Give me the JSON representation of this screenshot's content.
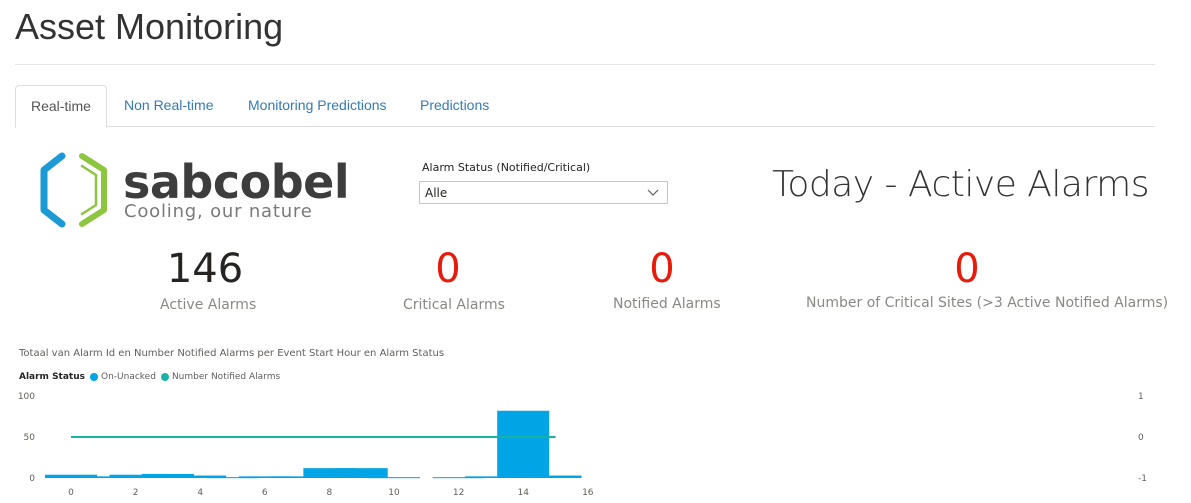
{
  "page": {
    "title": "Asset Monitoring"
  },
  "tabs": [
    {
      "label": "Real-time",
      "active": true
    },
    {
      "label": "Non Real-time",
      "active": false
    },
    {
      "label": "Monitoring Predictions",
      "active": false
    },
    {
      "label": "Predictions",
      "active": false
    }
  ],
  "logo": {
    "word": "sabcobel",
    "tagline": "Cooling, our nature",
    "colors": {
      "blue": "#1c9ad6",
      "green": "#8cc63f"
    }
  },
  "filter": {
    "label": "Alarm Status (Notified/Critical)",
    "value": "Alle"
  },
  "today_title": "Today - Active Alarms",
  "kpis": [
    {
      "value": "146",
      "label": "Active Alarms",
      "color": "#252423"
    },
    {
      "value": "0",
      "label": "Critical Alarms",
      "color": "#e81a0c"
    },
    {
      "value": "0",
      "label": "Notified Alarms",
      "color": "#e81a0c"
    },
    {
      "value": "0",
      "label": "Number of Critical Sites (>3 Active Notified Alarms)",
      "color": "#e81a0c"
    }
  ],
  "chart_data": {
    "type": "bar",
    "title": "Totaal van Alarm Id en Number Notified Alarms per Event Start Hour en Alarm Status",
    "legend_title": "Alarm Status",
    "legend_position": "top-left",
    "series": [
      {
        "name": "On-Unacked",
        "type": "bar",
        "color": "#01a4e4",
        "axis": "left",
        "x": [
          0,
          1,
          2,
          3,
          4,
          5,
          6,
          7,
          8,
          9,
          10,
          12,
          13,
          14,
          15
        ],
        "values": [
          4,
          2,
          4,
          5,
          3,
          1,
          2,
          2,
          12,
          12,
          1,
          1,
          2,
          82,
          3
        ]
      },
      {
        "name": "Number Notified Alarms",
        "type": "line",
        "color": "#1ab2a8",
        "axis": "right",
        "x": [
          0,
          15
        ],
        "values": [
          0,
          0
        ]
      }
    ],
    "x_ticks": [
      "0",
      "2",
      "4",
      "6",
      "8",
      "10",
      "12",
      "14",
      "16"
    ],
    "xlim": [
      0,
      16
    ],
    "y_left_ticks": [
      "100",
      "50",
      "0"
    ],
    "ylim_left": [
      0,
      100
    ],
    "y_right_ticks": [
      "1",
      "0",
      "-1"
    ],
    "ylim_right": [
      -1,
      1
    ],
    "grid": false
  }
}
